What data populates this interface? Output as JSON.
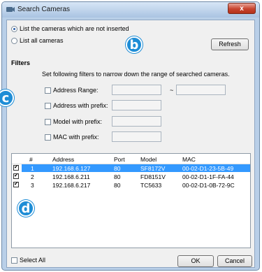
{
  "window": {
    "title": "Search Cameras",
    "close_label": "x"
  },
  "options": {
    "not_inserted_label": "List the cameras which are not inserted",
    "all_label": "List all cameras",
    "refresh_label": "Refresh"
  },
  "filters": {
    "heading": "Filters",
    "hint": "Set following filters to narrow down the range of searched cameras.",
    "address_range_label": "Address Range:",
    "range_separator": "~",
    "address_prefix_label": "Address with prefix:",
    "model_prefix_label": "Model with prefix:",
    "mac_prefix_label": "MAC with prefix:"
  },
  "table": {
    "columns": [
      "#",
      "Address",
      "Port",
      "Model",
      "MAC"
    ],
    "rows": [
      {
        "num": "1",
        "address": "192.168.6.127",
        "port": "80",
        "model": "SF8172V",
        "mac": "00-02-D1-23-5B-49",
        "selected": true
      },
      {
        "num": "2",
        "address": "192.168.6.211",
        "port": "80",
        "model": "FD8151V",
        "mac": "00-02-D1-1F-FA-44",
        "selected": false
      },
      {
        "num": "3",
        "address": "192.168.6.217",
        "port": "80",
        "model": "TC5633",
        "mac": "00-02-D1-0B-72-9C",
        "selected": false
      }
    ]
  },
  "footer": {
    "select_all_label": "Select All",
    "ok_label": "OK",
    "cancel_label": "Cancel"
  },
  "markers": {
    "b": "b",
    "c": "c",
    "d": "d"
  },
  "colors": {
    "selection": "#3399ff",
    "marker": "#1e8dd6"
  }
}
